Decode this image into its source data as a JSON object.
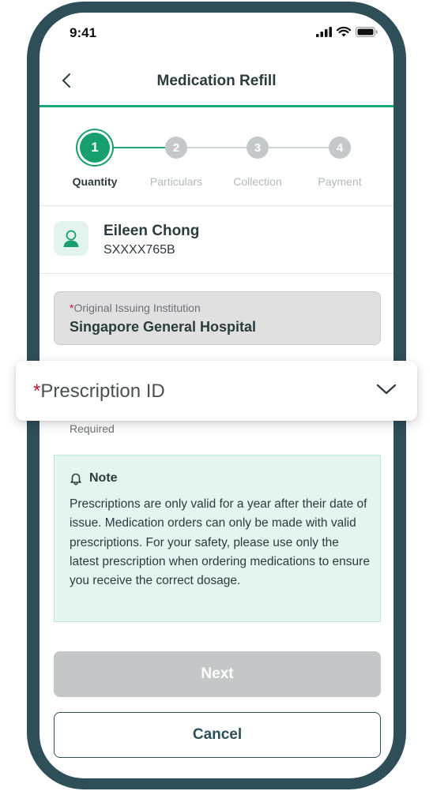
{
  "status_bar": {
    "time": "9:41"
  },
  "header": {
    "title": "Medication Refill"
  },
  "stepper": {
    "steps": [
      {
        "number": "1",
        "label": "Quantity"
      },
      {
        "number": "2",
        "label": "Particulars"
      },
      {
        "number": "3",
        "label": "Collection"
      },
      {
        "number": "4",
        "label": "Payment"
      }
    ],
    "current_step": 1
  },
  "patient": {
    "name": "Eileen Chong",
    "id": "SXXXX765B"
  },
  "institution_field": {
    "required_marker": "*",
    "label": "Original Issuing Institution",
    "value": "Singapore General Hospital"
  },
  "prescription_field": {
    "required_marker": "*",
    "label": "Prescription ID",
    "helper": "Required"
  },
  "note": {
    "title": "Note",
    "body": "Prescriptions are only valid for a year after their date of issue. Medication orders can only be made with valid prescriptions. For your safety, please use only the latest prescription when ordering medications to ensure you receive the correct dosage."
  },
  "buttons": {
    "next": "Next",
    "cancel": "Cancel"
  },
  "colors": {
    "frame": "#2e4e58",
    "accent": "#17a06e",
    "note_bg": "#e4f5ef",
    "required": "#c8102e"
  }
}
